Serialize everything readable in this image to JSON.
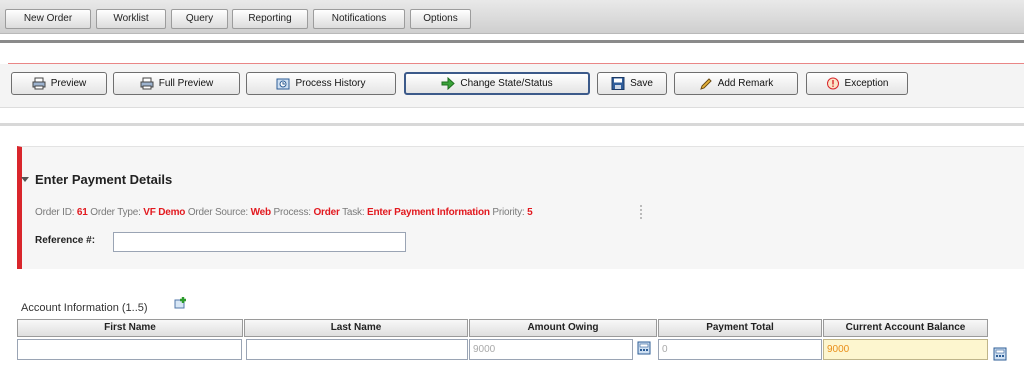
{
  "menu": [
    "New Order",
    "Worklist",
    "Query",
    "Reporting",
    "Notifications",
    "Options"
  ],
  "toolbar": {
    "preview": "Preview",
    "full_preview": "Full Preview",
    "process_history": "Process History",
    "change_state": "Change State/Status",
    "save": "Save",
    "add_remark": "Add Remark",
    "exception": "Exception"
  },
  "panel": {
    "title": "Enter Payment Details",
    "order_id_label": "Order ID:",
    "order_id": "61",
    "order_type_label": "Order Type:",
    "order_type": "VF Demo",
    "order_source_label": "Order Source:",
    "order_source": "Web",
    "process_label": "Process:",
    "process": "Order",
    "task_label": "Task:",
    "task": "Enter Payment Information",
    "priority_label": "Priority:",
    "priority": "5",
    "reference_label": "Reference #:",
    "reference_value": ""
  },
  "account": {
    "title": "Account Information (1..5)",
    "columns": [
      "First Name",
      "Last Name",
      "Amount Owing",
      "Payment Total",
      "Current Account Balance"
    ],
    "row": {
      "first_name": "",
      "last_name": "",
      "amount_owing": "9000",
      "payment_total": "0",
      "current_balance": "9000"
    }
  },
  "colors": {
    "accent_red": "#d9262c",
    "value_red": "#e2191f",
    "highlight_bg": "#fdf6cf",
    "highlight_text": "#e98f1a"
  },
  "icons": {
    "preview": "printer-icon",
    "full_preview": "printer-icon",
    "process_history": "history-icon",
    "change_state": "green-arrow-icon",
    "save": "floppy-disk-icon",
    "add_remark": "pencil-icon",
    "exception": "exclamation-circle-icon",
    "add_row": "add-row-icon",
    "calculator": "calculator-icon"
  }
}
